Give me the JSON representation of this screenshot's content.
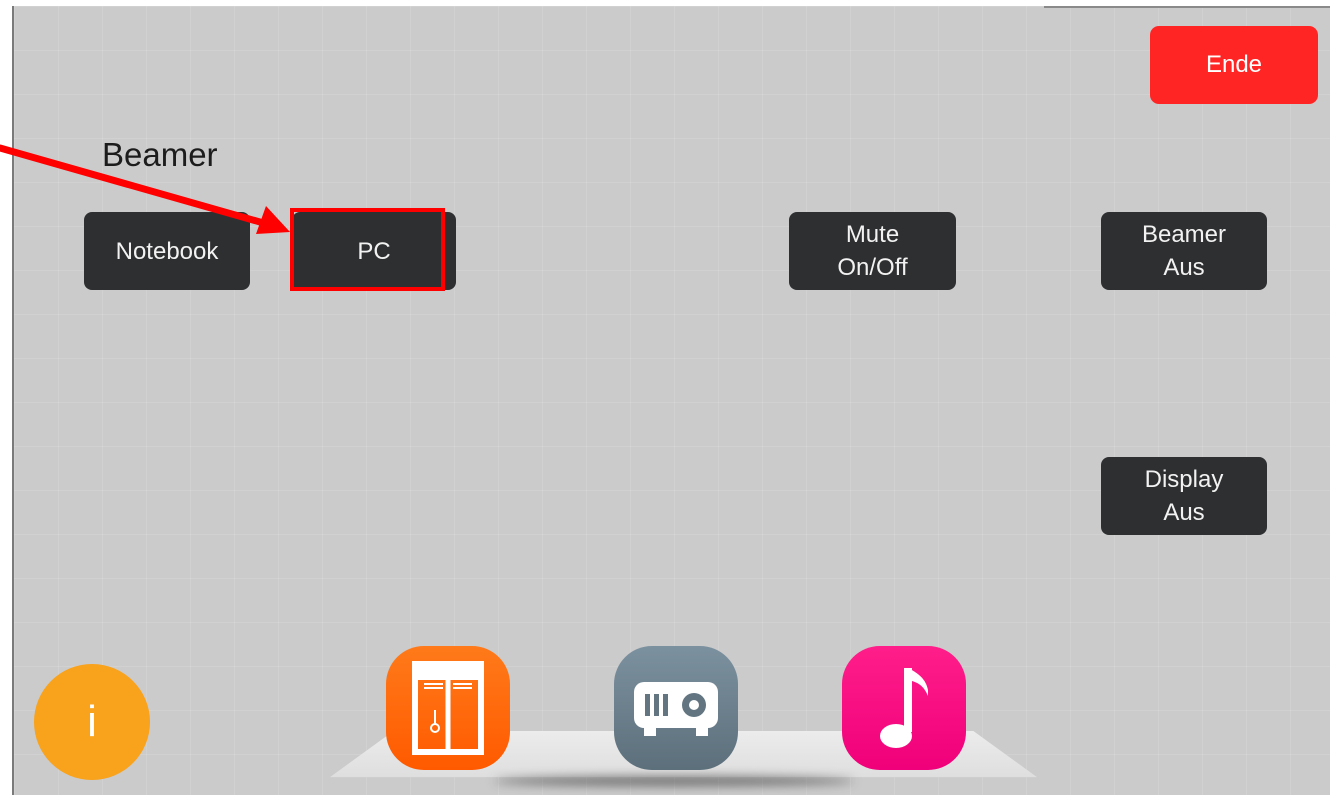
{
  "screen": {
    "title": "Beamer",
    "end_button": "Ende"
  },
  "buttons": {
    "notebook": "Notebook",
    "pc": "PC",
    "mute_line1": "Mute",
    "mute_line2": "On/Off",
    "beamer_off_line1": "Beamer",
    "beamer_off_line2": "Aus",
    "display_off_line1": "Display",
    "display_off_line2": "Aus"
  },
  "dock": {
    "info_label": "i",
    "icons": [
      "info-icon",
      "blinds-icon",
      "projector-icon",
      "music-note-icon"
    ]
  },
  "annotation": {
    "color": "#ff0000",
    "target": "pc"
  },
  "colors": {
    "background": "#cbcbcb",
    "button": "#2e2f31",
    "end_button": "#ff2525",
    "info": "#f9a21b",
    "blinds": "#ff6a00",
    "beamer": "#6b7f8b",
    "music": "#f5007f"
  }
}
